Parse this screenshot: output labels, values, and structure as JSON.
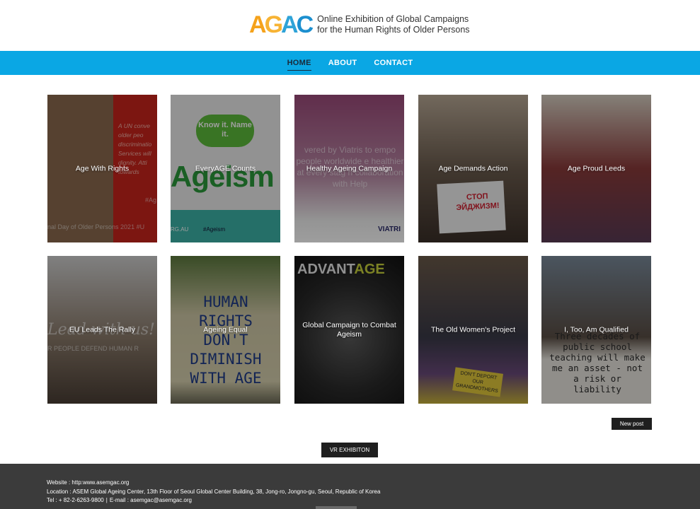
{
  "logo": {
    "mark": [
      "A",
      "G",
      "A",
      "C"
    ],
    "line1": "Online Exhibition of Global Campaigns",
    "line2": "for the Human Rights of Older Persons"
  },
  "nav": {
    "items": [
      {
        "label": "HOME",
        "active": true
      },
      {
        "label": "ABOUT",
        "active": false
      },
      {
        "label": "CONTACT",
        "active": false
      }
    ]
  },
  "posts": [
    {
      "title": "Age With Rights"
    },
    {
      "title": "EveryAGE Counts"
    },
    {
      "title": "Healthy Ageing Campaign"
    },
    {
      "title": "Age Demands Action"
    },
    {
      "title": "Age Proud Leeds"
    },
    {
      "title": "EU Leads The Rally"
    },
    {
      "title": "Ageing Equal"
    },
    {
      "title": "Global Campaign to Combat Ageism"
    },
    {
      "title": "The Old Women's Project"
    },
    {
      "title": "I, Too, Am Qualified"
    }
  ],
  "image_text": {
    "c1_body": "A UN conve older peo discriminatio Services will dignity. Atti towards",
    "c1_tag": "#Ag",
    "c1_bottom": "nal Day of Older Persons 2021   #U",
    "c2_bubble": "Know it. Name it.",
    "c2_word": "Ageism",
    "c2_bottom_left": "RG.AU",
    "c2_bottom_tag": "#Ageism",
    "c3_text": "vered by Viatris to empo people worldwide e healthier at every stag n collaboration with Help",
    "c3_brand": "VIATRI",
    "c4_sign": "СТОП ЭЙДЖИЗМ!",
    "c6_text": "Lead with us!",
    "c6_sub": "R PEOPLE DEFEND HUMAN R",
    "c7_sign": "HUMAN RIGHTS DON'T DIMINISH WITH AGE",
    "c8_brand_a": "ADVANT",
    "c8_brand_b": "AGE",
    "c9_sign": "DON'T DEPORT OUR GRANDMOTHERS",
    "c10_sign": "Three decades of public school teaching will make me an asset - not a risk or liability"
  },
  "buttons": {
    "new_post": "New post",
    "vr": "VR EXHIBITON"
  },
  "footer": {
    "website": "Website : http:www.asemgac.org",
    "location": "Location : ASEM Global Ageing Center, 13th Floor of Seoul Global Center Building, 38, Jong-ro, Jongno-gu, Seoul, Republic of Korea",
    "tel": "Tel : + 82-2-6263-9800",
    "separator": "|",
    "email": "E-mail : asemgac@asemgac.org"
  },
  "colors": {
    "nav_bg": "#0aa7e4",
    "footer_bg": "#3b3b3b",
    "button_bg": "#1f1f1f"
  }
}
